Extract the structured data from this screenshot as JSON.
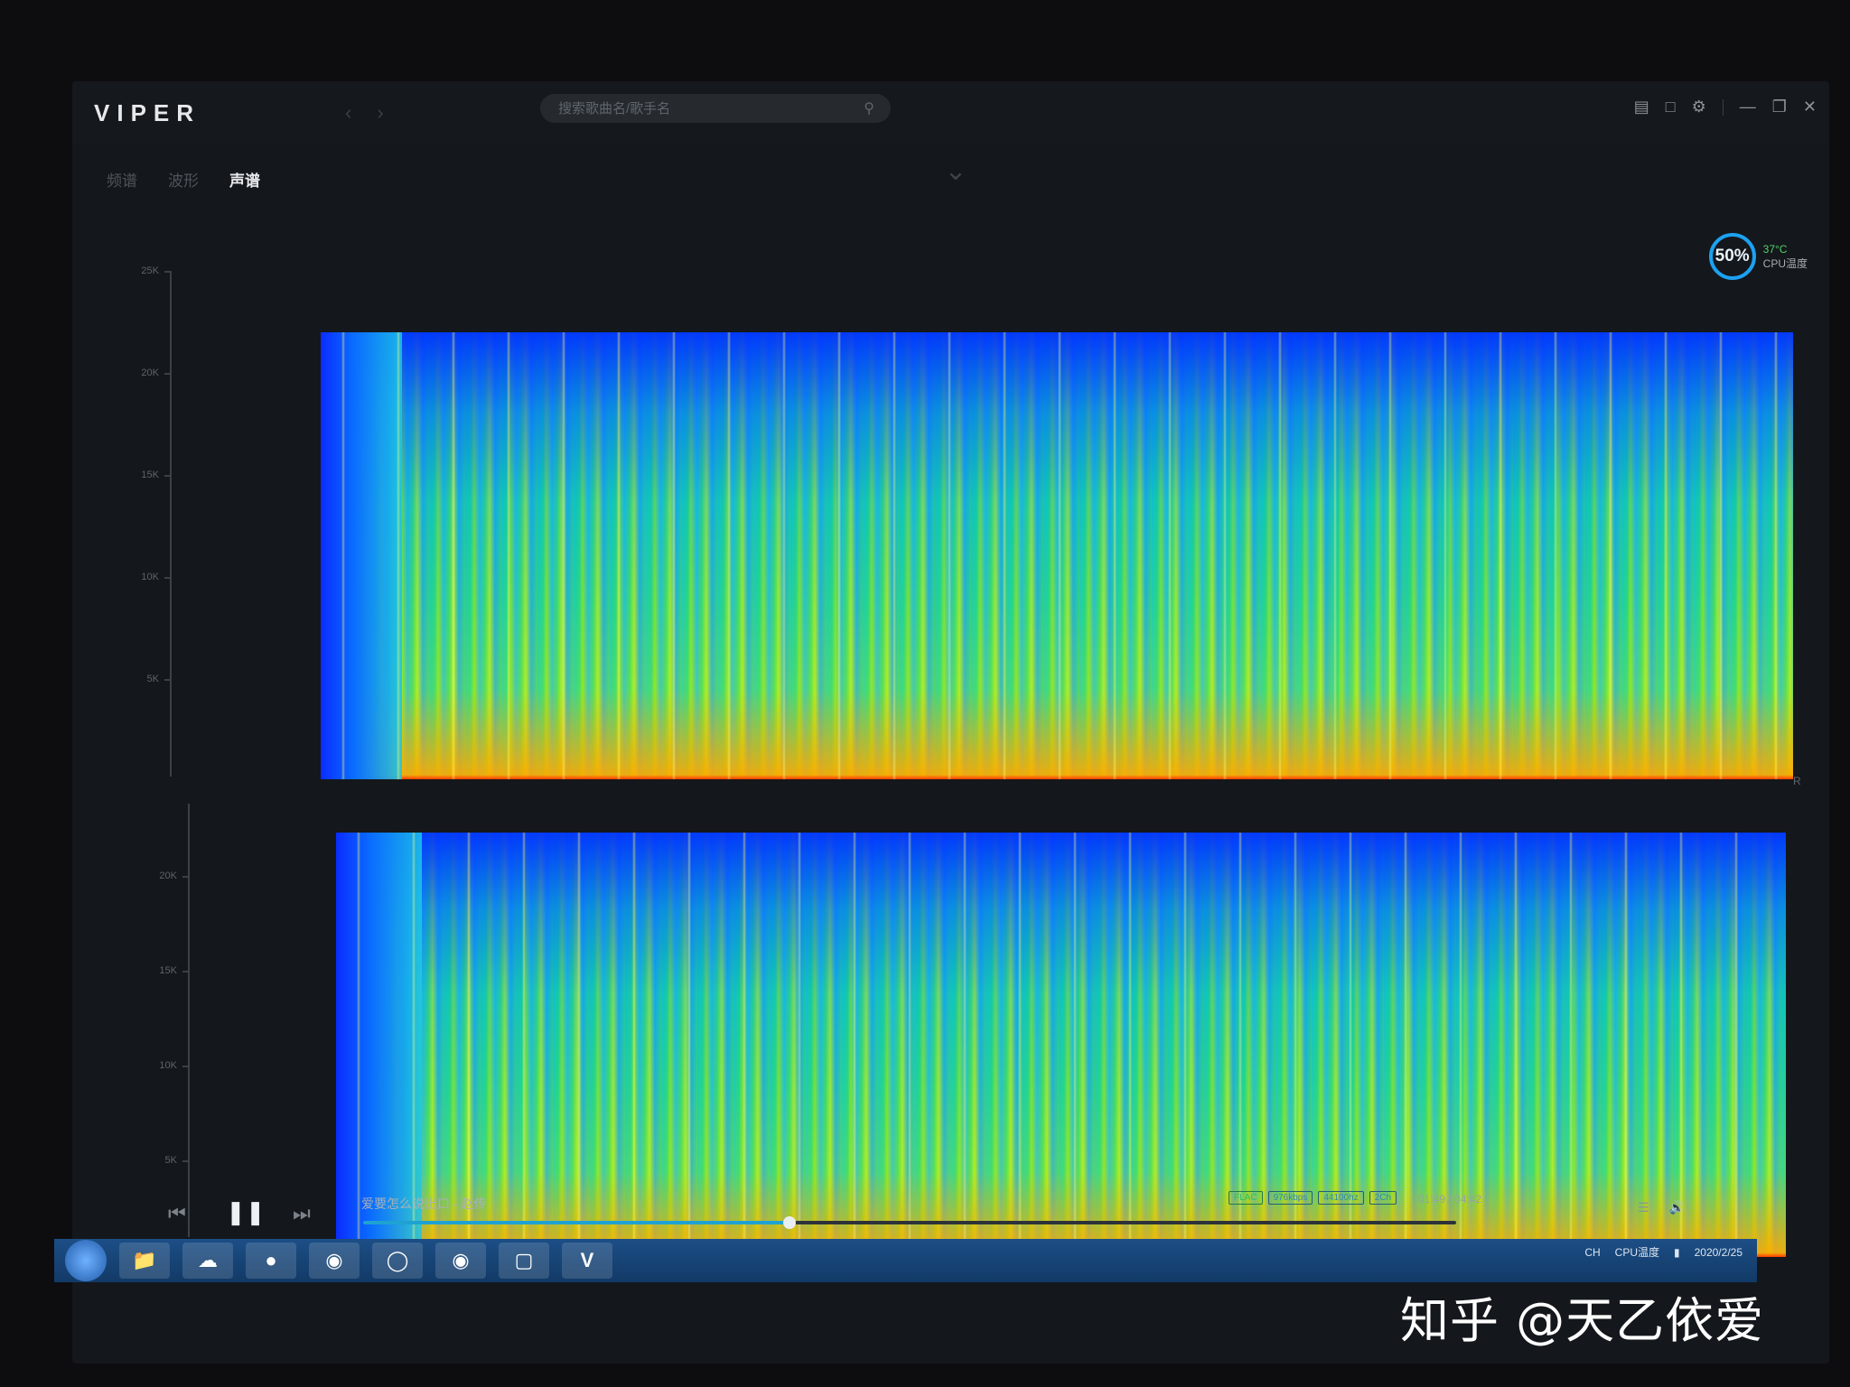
{
  "app": {
    "title": "VIPER"
  },
  "search": {
    "placeholder": "搜索歌曲名/歌手名"
  },
  "tabs": [
    {
      "label": "频谱"
    },
    {
      "label": "波形"
    },
    {
      "label": "声谱"
    }
  ],
  "cpu": {
    "percent": "50%",
    "temp": "37°C",
    "label": "CPU温度"
  },
  "axis_top": {
    "ticks": [
      "25K",
      "20K",
      "15K",
      "10K",
      "5K"
    ]
  },
  "axis_bottom": {
    "ticks": [
      "20K",
      "15K",
      "10K",
      "5K"
    ]
  },
  "channels": {
    "right": "R"
  },
  "player": {
    "track": "爱要怎么说出口 - 赵传",
    "badges": [
      "FLAC",
      "976kbps",
      "44100hz",
      "2Ch"
    ],
    "time": "01:49 / 04:42",
    "progress": 0.39
  },
  "tray": {
    "lang": "CH",
    "label": "CPU温度",
    "date": "2020/2/25"
  },
  "watermark": "知乎 @天乙依爱",
  "colors": {
    "accent": "#1fa2d2",
    "badge": "#2ebd6d",
    "spectrogram_low": "#ff8c00",
    "spectrogram_high": "#0a2cff"
  }
}
